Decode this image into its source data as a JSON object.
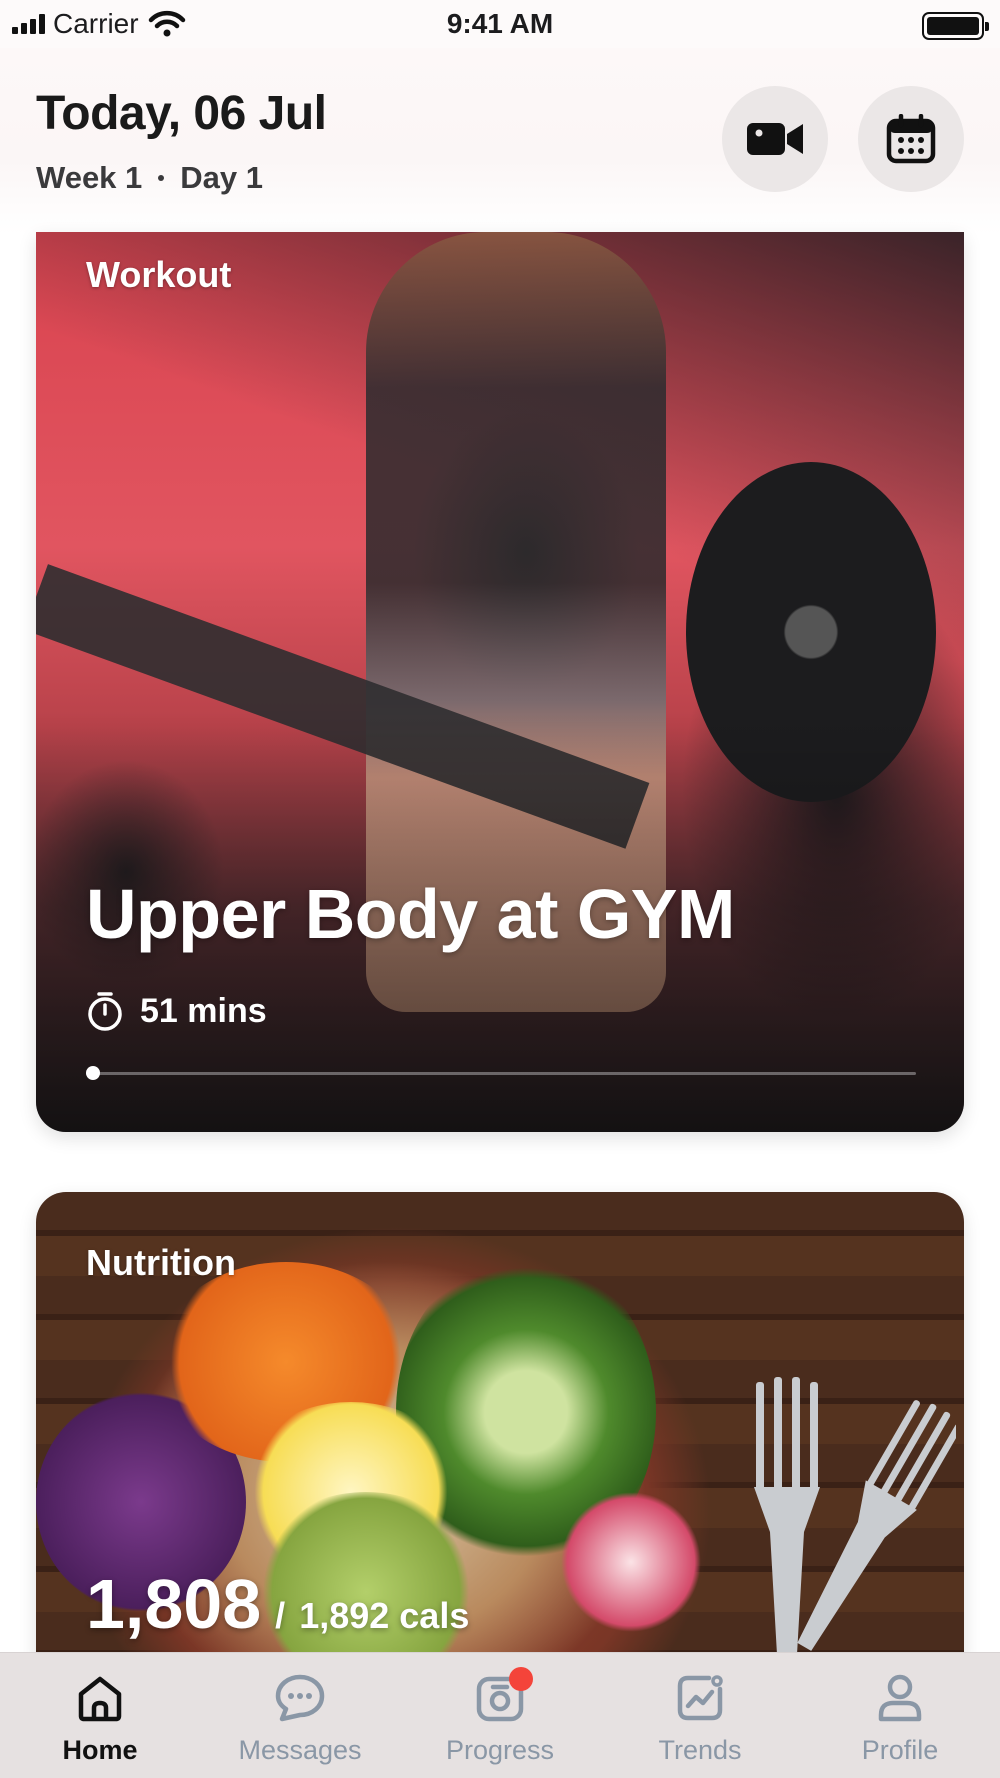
{
  "status_bar": {
    "carrier": "Carrier",
    "time": "9:41 AM"
  },
  "header": {
    "title": "Today, 06 Jul",
    "week": "Week 1",
    "day": "Day 1",
    "buttons": {
      "video_icon": "video-camera-icon",
      "calendar_icon": "calendar-icon"
    }
  },
  "workout_card": {
    "label": "Workout",
    "title": "Upper Body at GYM",
    "duration": "51 mins",
    "progress": 0.0
  },
  "nutrition_card": {
    "label": "Nutrition",
    "consumed": "1,808",
    "separator": "/",
    "target": "1,892 cals"
  },
  "tab_bar": {
    "items": [
      {
        "label": "Home",
        "icon": "home-icon",
        "active": true
      },
      {
        "label": "Messages",
        "icon": "chat-bubble-icon",
        "active": false
      },
      {
        "label": "Progress",
        "icon": "camera-icon",
        "active": false,
        "badge": true
      },
      {
        "label": "Trends",
        "icon": "chart-icon",
        "active": false
      },
      {
        "label": "Profile",
        "icon": "person-icon",
        "active": false
      }
    ],
    "active_color": "#111111",
    "inactive_color": "#8a97a6",
    "badge_color": "#f4443a"
  }
}
